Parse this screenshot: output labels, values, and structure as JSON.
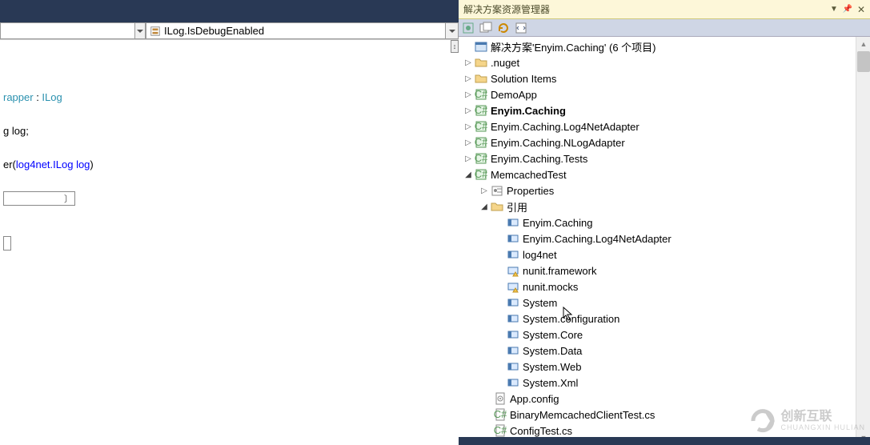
{
  "editor": {
    "member_combo": "ILog.IsDebugEnabled",
    "code": {
      "line1_a": "rapper",
      "line1_b": " : ",
      "line1_c": "ILog",
      "line2_a": "g ",
      "line2_b": "log;",
      "line3_a": "er(",
      "line3_b": "log4net.ILog log",
      "line3_c": ")"
    }
  },
  "panel": {
    "title": "解决方案资源管理器",
    "solution_label": "解决方案'Enyim.Caching' (6 个项目)"
  },
  "tree": {
    "nuget": ".nuget",
    "solution_items": "Solution Items",
    "demoapp": "DemoApp",
    "enyim_caching": "Enyim.Caching",
    "log4net_adapter": "Enyim.Caching.Log4NetAdapter",
    "nlog_adapter": "Enyim.Caching.NLogAdapter",
    "tests": "Enyim.Caching.Tests",
    "memcached_test": "MemcachedTest",
    "properties": "Properties",
    "references": "引用",
    "ref_enyim": "Enyim.Caching",
    "ref_log4netadapter": "Enyim.Caching.Log4NetAdapter",
    "ref_log4net": "log4net",
    "ref_nunit_fw": "nunit.framework",
    "ref_nunit_mocks": "nunit.mocks",
    "ref_system": "System",
    "ref_sys_config": "System.configuration",
    "ref_sys_core": "System.Core",
    "ref_sys_data": "System.Data",
    "ref_sys_web": "System.Web",
    "ref_sys_xml": "System.Xml",
    "app_config": "App.config",
    "binary_test": "BinaryMemcachedClientTest.cs",
    "config_test": "ConfigTest.cs"
  },
  "watermark": {
    "title": "创新互联",
    "sub": "CHUANGXIN HULIAN"
  }
}
